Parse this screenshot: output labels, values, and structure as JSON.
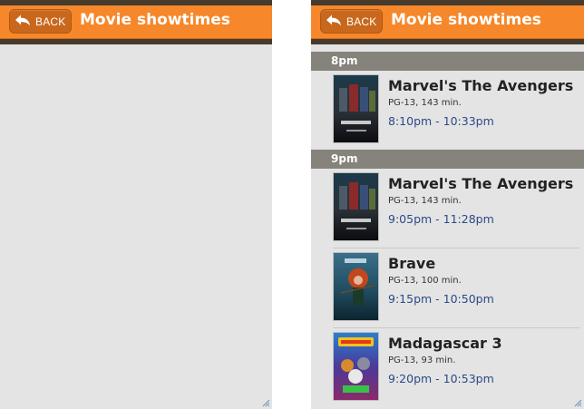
{
  "header": {
    "back_label": "BACK",
    "title": "Movie showtimes"
  },
  "colors": {
    "header_orange": "#f6872a",
    "back_button": "#c9681d",
    "dark_bar": "#463b2d",
    "section_header": "#85837b",
    "time_link": "#2a4a88",
    "background": "#e4e4e4"
  },
  "icons": {
    "back": "back-arrow-icon",
    "resize": "resize-grip-icon"
  },
  "sections": [
    {
      "label": "8pm",
      "items": [
        {
          "title": "Marvel's The Avengers",
          "meta": "PG-13, 143 min.",
          "time": "8:10pm - 10:33pm",
          "poster": "avengers-poster"
        }
      ]
    },
    {
      "label": "9pm",
      "items": [
        {
          "title": "Marvel's The Avengers",
          "meta": "PG-13, 143 min.",
          "time": "9:05pm - 11:28pm",
          "poster": "avengers-poster"
        },
        {
          "title": "Brave",
          "meta": "PG-13, 100 min.",
          "time": "9:15pm - 10:50pm",
          "poster": "brave-poster"
        },
        {
          "title": "Madagascar 3",
          "meta": "PG-13, 93 min.",
          "time": "9:20pm - 10:53pm",
          "poster": "madagascar3-poster"
        }
      ]
    }
  ]
}
